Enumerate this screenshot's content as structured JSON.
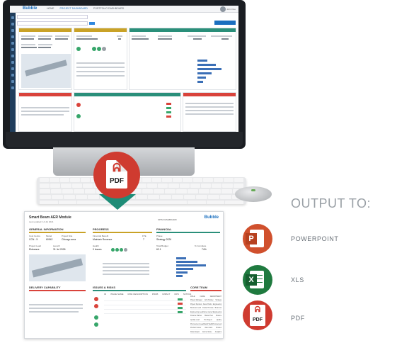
{
  "app": {
    "logo": "Bubble",
    "nav": [
      "HOME",
      "PROJECT DASHBOARD",
      "PORTFOLIO DASHBOARD"
    ],
    "user": "John Doe"
  },
  "pdf_badge": {
    "label": "PDF"
  },
  "report": {
    "title": "Smart Beam AER Module",
    "subtitle": "Last updated: 14 Jul 2021",
    "logo": "Bubble",
    "doc_type": "KPIS DASHBOARD",
    "sections": {
      "general": "GENERAL INFORMATION",
      "progress": "PROGRESS",
      "financial": "FINANCIAL",
      "delivery": "DELIVERY CAPABILITY",
      "issues": "ISSUES & RISKS",
      "team": "CORE TEAM"
    },
    "fields": {
      "cost_centre": "Cost Centre",
      "cost_centre_val": "CCN - 5",
      "model": "Model",
      "model_val": "60942",
      "project_site": "Project Site",
      "project_site_val": "Chicago area",
      "phase": "Phase",
      "phase_val": "Strategy 2026",
      "project_lead": "Project Lead",
      "project_lead_val": "Ekkorana",
      "launch": "Launch",
      "launch_val": "31 Jul 2026",
      "financial_benefit": "Financial Benefit",
      "financial_benefit_val": "Maintain Revenue",
      "fte": "FTE",
      "fte_val": "7",
      "health": "Health",
      "health_val": "0 Issues",
      "total_budget": "Total Budget",
      "total_budget_val": "62.1",
      "pct_complete": "% Complete",
      "pct_val": "74%",
      "project_site_2": "Project Site",
      "project_vendor": "Project Vendor",
      "cost_centre_2": "Cost Centre"
    },
    "issue_table_headers": [
      "ID",
      "ISSUE NAME",
      "RISK DESCRIPTION",
      "PROB",
      "IMPACT",
      "RPN",
      "STATUS"
    ],
    "team_headers": [
      "ROLE",
      "NAME",
      "DEPARTMENT"
    ],
    "team_rows": [
      [
        "Project Manager",
        "John Mosley",
        "Strategy"
      ],
      [
        "Project Sponsor",
        "Alexa Harris",
        "Engineering"
      ],
      [
        "Business Lead",
        "Daniel Thomas",
        "Business"
      ],
      [
        "Engineering Lead",
        "Karen Lopez",
        "Engineering"
      ],
      [
        "Finance Partner",
        "Maria Chen",
        "Finance"
      ],
      [
        "Quality Lead",
        "Tim Rogers",
        "Quality"
      ],
      [
        "Procurement Lead",
        "Sarah Wells",
        "Procurement"
      ],
      [
        "Product Owner",
        "Alan Grant",
        "Product"
      ],
      [
        "Data Analyst",
        "Emma Stone",
        "Analytics"
      ]
    ]
  },
  "output": {
    "heading": "OUTPUT TO:",
    "targets": [
      "POWERPOINT",
      "XLS",
      "PDF"
    ],
    "ppt_letter": "P",
    "xls_letter": "X"
  },
  "colors": {
    "pdf_red": "#cf3b30",
    "arrow_teal": "#1e8c77",
    "ppt_orange": "#d0502d",
    "xls_green": "#1f7a3f",
    "accent_blue": "#1b6fbf",
    "section_yellow": "#c9a227",
    "section_teal": "#2a8f7a",
    "section_red": "#d9433b"
  }
}
